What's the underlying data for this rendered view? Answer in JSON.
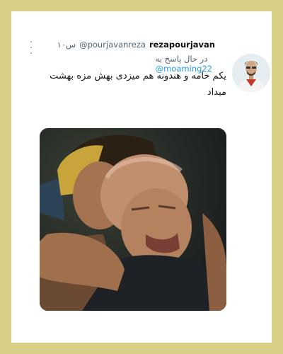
{
  "tweet": {
    "author_name": "rezapourjavan",
    "author_handle": "@pourjavanreza",
    "timestamp": "۱۰س",
    "reply_prefix": "در حال پاسخ به",
    "reply_to": "@moaming22",
    "text": "یکم خامه و هندونه هم میزدی بهش مزه بهشت میداد",
    "more_icon": "vertical-ellipsis-icon",
    "media_description_icon": "photo"
  },
  "colors": {
    "frame": "#d8cf86",
    "card": "#ffffff",
    "mention": "#1d9bf0",
    "secondary_text": "#536471"
  }
}
